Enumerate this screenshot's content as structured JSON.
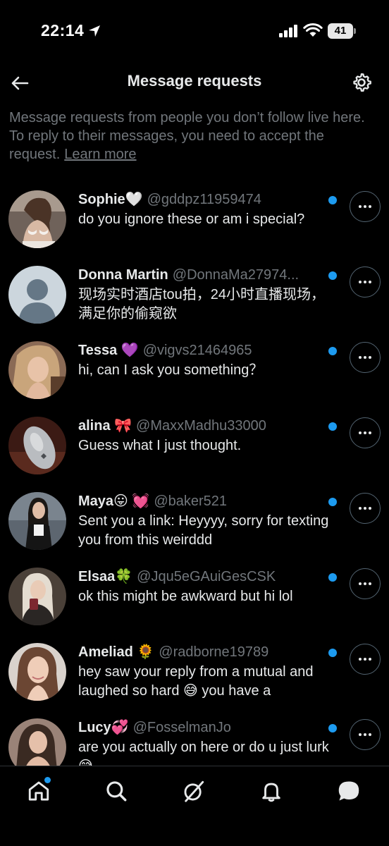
{
  "status_bar": {
    "time": "22:14",
    "battery": "41"
  },
  "header": {
    "title": "Message requests"
  },
  "intro": {
    "text": "Message requests from people you don’t follow live here. To reply to their messages, you need to accept the request.",
    "learn_more": "Learn more"
  },
  "requests": [
    {
      "name": "Sophie🤍",
      "handle": "@gddpz11959474",
      "message": "do you ignore these or am i special?"
    },
    {
      "name": "Donna Martin",
      "handle": "@DonnaMa27974...",
      "message": "现场实时酒店tou拍，24小时直播现场，满足你的偷窥欲"
    },
    {
      "name": "Tessa 💜",
      "handle": "@vigvs21464965",
      "message": "hi, can I ask you something？"
    },
    {
      "name": "alina 🎀",
      "handle": "@MaxxMadhu33000",
      "message": "Guess what I just thought."
    },
    {
      "name": "Maya😛 💓",
      "handle": "@baker521",
      "message": "Sent you a link: Heyyyy, sorry for texting you from this weirddd"
    },
    {
      "name": "Elsaa🍀",
      "handle": "@Jqu5eGAuiGesCSK",
      "message": "ok this might be awkward but hi lol"
    },
    {
      "name": "Ameliad 🌻",
      "handle": "@radborne19789",
      "message": "hey saw your reply from a mutual and laughed so hard 😅 you have a"
    },
    {
      "name": "Lucy💞",
      "handle": "@FosselmanJo",
      "message": "are you actually on here or do u just lurk 😅"
    }
  ],
  "colors": {
    "accent": "#1d9bf0",
    "text": "#e7e9ea",
    "muted": "#71767b",
    "background": "#000000"
  },
  "icons": {
    "back": "arrow-left-icon",
    "settings": "gear-icon",
    "home": "home-icon",
    "search": "search-icon",
    "grok": "grok-icon",
    "notifications": "bell-icon",
    "messages": "message-icon"
  }
}
